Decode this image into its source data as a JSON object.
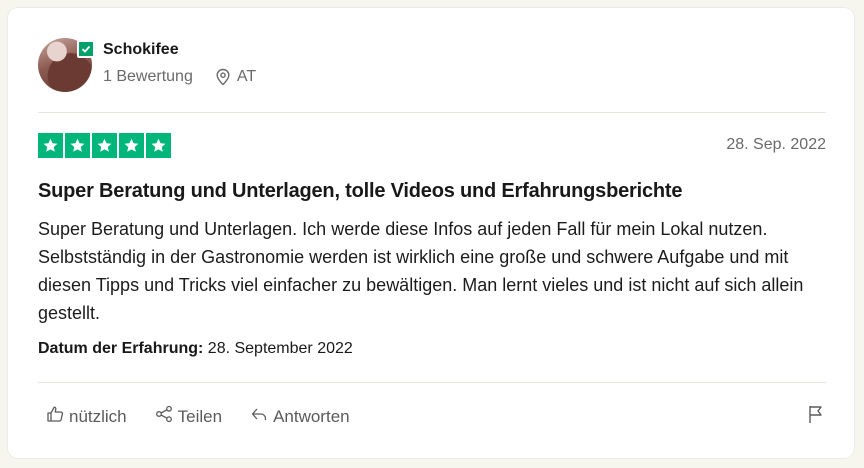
{
  "review": {
    "author": "Schokifee",
    "review_count": "1 Bewertung",
    "country": "AT",
    "rating": 5,
    "date": "28. Sep. 2022",
    "title": "Super Beratung und Unterlagen, tolle Videos und Erfahrungsberichte",
    "body": "Super Beratung und Unterlagen. Ich werde diese Infos auf jeden Fall für mein Lokal nutzen. Selbstständig in der Gastronomie werden ist wirklich eine große und schwere Aufgabe und mit diesen Tipps und Tricks viel einfacher zu bewältigen. Man lernt vieles und ist nicht auf sich allein gestellt.",
    "experience_label": "Datum der Erfahrung:",
    "experience_date": "28. September 2022"
  },
  "actions": {
    "useful": "nützlich",
    "share": "Teilen",
    "reply": "Antworten"
  },
  "icons": {
    "verified": "verified-check-icon",
    "location": "location-pin-icon",
    "star": "star-icon",
    "thumbs_up": "thumbs-up-icon",
    "share": "share-icon",
    "reply": "reply-arrow-icon",
    "flag": "flag-icon"
  },
  "colors": {
    "star_green": "#00b67a",
    "verified_green": "#04a26b",
    "background": "#f7f6ee"
  }
}
